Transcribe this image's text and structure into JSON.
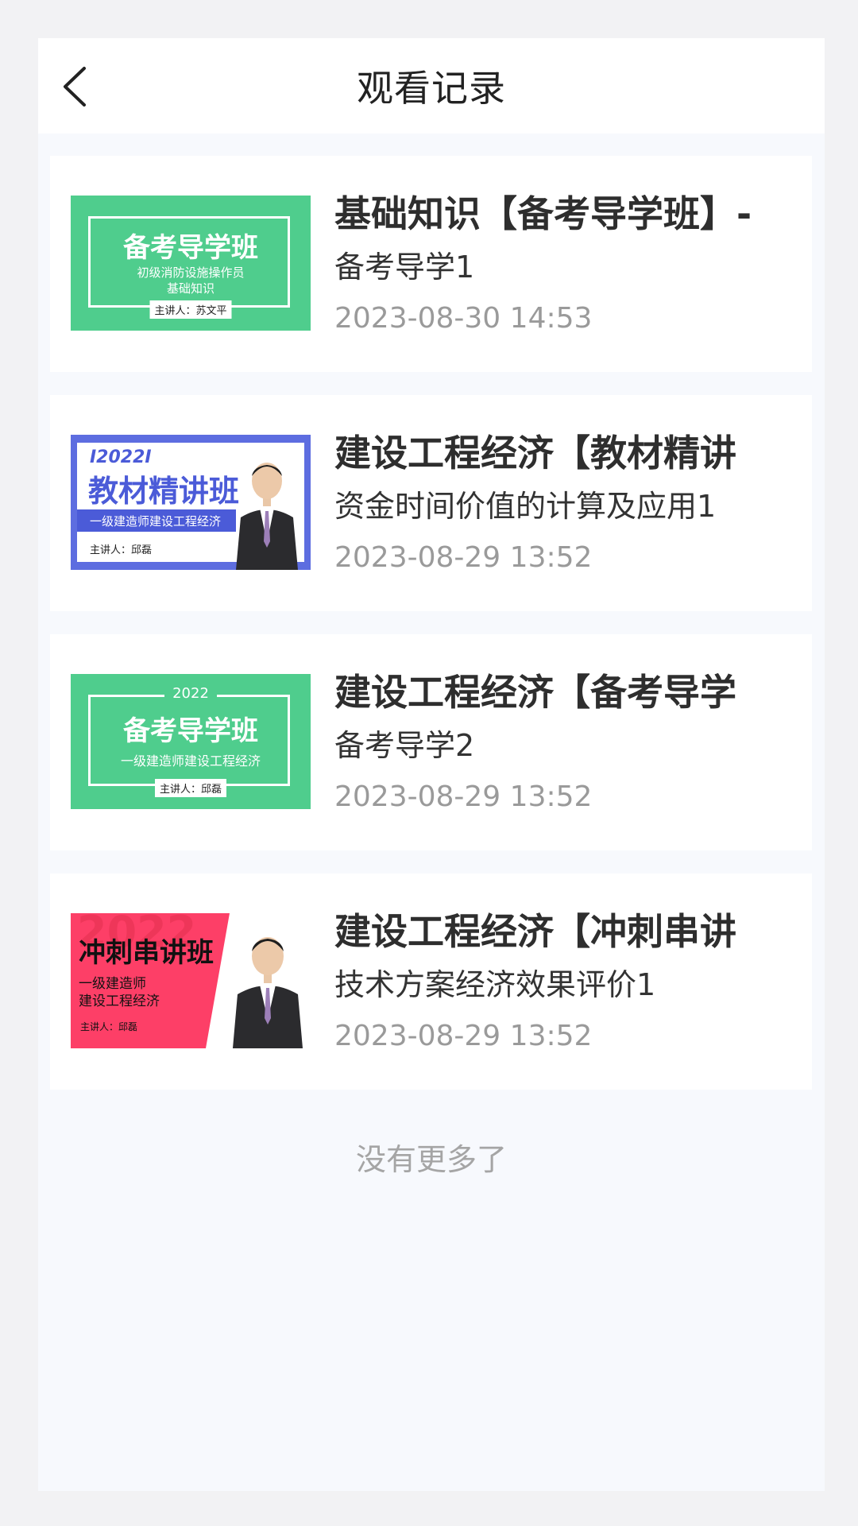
{
  "header": {
    "title": "观看记录",
    "back_icon": "chevron-left-icon"
  },
  "records": [
    {
      "title": "基础知识【备考导学班】-",
      "subtitle": "备考导学1",
      "time": "2023-08-30 14:53",
      "thumb": {
        "style": "green",
        "big": "备考导学班",
        "line1": "初级消防设施操作员",
        "line2": "基础知识",
        "tag": "主讲人：苏文平"
      }
    },
    {
      "title": "建设工程经济【教材精讲",
      "subtitle": "资金时间价值的计算及应用1",
      "time": "2023-08-29 13:52",
      "thumb": {
        "style": "blue",
        "year": "I2022I",
        "big": "教材精讲班",
        "line1": "一级建造师建设工程经济",
        "tag": "主讲人：邱磊"
      }
    },
    {
      "title": "建设工程经济【备考导学",
      "subtitle": "备考导学2",
      "time": "2023-08-29 13:52",
      "thumb": {
        "style": "green",
        "year": "2022",
        "big": "备考导学班",
        "line1": "一级建造师建设工程经济",
        "tag": "主讲人：邱磊"
      }
    },
    {
      "title": "建设工程经济【冲刺串讲",
      "subtitle": "技术方案经济效果评价1",
      "time": "2023-08-29 13:52",
      "thumb": {
        "style": "red",
        "bg_year": "2022",
        "big": "冲刺串讲班",
        "line1": "一级建造师",
        "line2": "建设工程经济",
        "tag": "主讲人：邱磊"
      }
    }
  ],
  "footer": {
    "text": "没有更多了"
  },
  "colors": {
    "green": "#4fcd8d",
    "blue": "#5d6de0",
    "red": "#fd3f67",
    "page_bg": "#f7f9fd"
  }
}
